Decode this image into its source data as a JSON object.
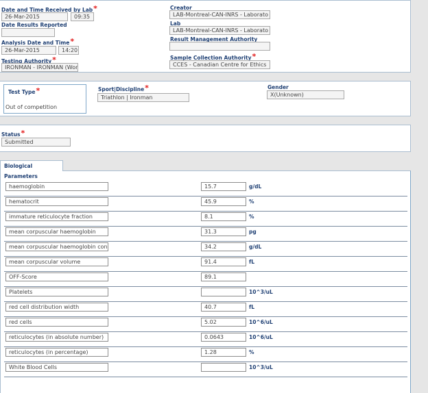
{
  "general": {
    "date_received_label": "Date and Time Received by Lab",
    "date_received_date": "26-Mar-2015",
    "date_received_time": "09:35",
    "date_reported_label": "Date Results Reported",
    "date_reported_value": "",
    "analysis_date_label": "Analysis Date and Time",
    "analysis_date": "26-Mar-2015",
    "analysis_time": "14:20",
    "testing_authority_label": "Testing Authority",
    "testing_authority_value": "IRONMAN - IRONMAN (Wor",
    "creator_label": "Creator",
    "creator_value": "LAB-Montreal-CAN-INRS - Laborato",
    "lab_label": "Lab",
    "lab_value": "LAB-Montreal-CAN-INRS - Laborato",
    "result_mgmt_label": "Result Management Authority",
    "result_mgmt_value": "",
    "sample_collection_label": "Sample Collection Authority",
    "sample_collection_value": "CCES - Canadian Centre for Ethics",
    "required_mark": "*"
  },
  "test": {
    "test_type_label": "Test Type",
    "test_type_value": "Out of competition",
    "sport_label": "Sport|Discipline",
    "sport_value": "Triathlon | Ironman",
    "gender_label": "Gender",
    "gender_value": "X(Unknown)"
  },
  "status": {
    "label": "Status",
    "value": "Submitted"
  },
  "bio_tab": {
    "label": "Biological Parameters"
  },
  "parameters": [
    {
      "name": "haemoglobin",
      "value": "15.7",
      "unit": "g/dL"
    },
    {
      "name": "hematocrit",
      "value": "45.9",
      "unit": "%"
    },
    {
      "name": "immature reticulocyte fraction",
      "value": "8.1",
      "unit": "%"
    },
    {
      "name": "mean corpuscular haemoglobin",
      "value": "31.3",
      "unit": "pg"
    },
    {
      "name": "mean corpuscular haemoglobin conc",
      "value": "34.2",
      "unit": "g/dL"
    },
    {
      "name": "mean corpuscular volume",
      "value": "91.4",
      "unit": "fL"
    },
    {
      "name": "OFF-Score",
      "value": "89.1",
      "unit": ""
    },
    {
      "name": "Platelets",
      "value": "",
      "unit": "10^3/uL"
    },
    {
      "name": "red cell distribution width",
      "value": "40.7",
      "unit": "fL"
    },
    {
      "name": "red cells",
      "value": "5.02",
      "unit": "10^6/uL"
    },
    {
      "name": "reticulocytes (in absolute number)",
      "value": "0.0643",
      "unit": "10^6/uL"
    },
    {
      "name": "reticulocytes (in percentage)",
      "value": "1.28",
      "unit": "%"
    },
    {
      "name": "White Blood Cells",
      "value": "",
      "unit": "10^3/uL"
    }
  ]
}
